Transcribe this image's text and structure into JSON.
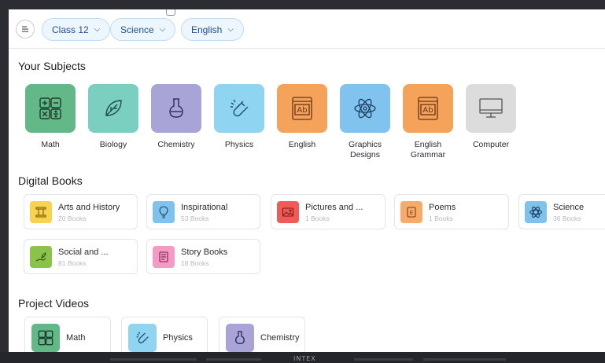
{
  "topbar": {
    "menu_icon": "menu-icon",
    "filters": [
      {
        "label": "Class 12"
      },
      {
        "label": "Science"
      },
      {
        "label": "English"
      }
    ]
  },
  "subjects_section": {
    "title": "Your Subjects",
    "items": [
      {
        "label": "Math",
        "icon": "calculator-icon",
        "color": "#62b887"
      },
      {
        "label": "Biology",
        "icon": "leaf-icon",
        "color": "#7bcfc0"
      },
      {
        "label": "Chemistry",
        "icon": "flask-icon",
        "color": "#a8a4d8"
      },
      {
        "label": "Physics",
        "icon": "magnet-icon",
        "color": "#8fd4f1"
      },
      {
        "label": "English",
        "icon": "ab-book-icon",
        "color": "#f5a35a"
      },
      {
        "label": "Graphics\nDesigns",
        "icon": "atom-icon",
        "color": "#7fc3ee"
      },
      {
        "label": "English\nGrammar",
        "icon": "ab-book-icon",
        "color": "#f5a35a"
      },
      {
        "label": "Computer",
        "icon": "monitor-icon",
        "color": "#dcdcdc"
      }
    ]
  },
  "books_section": {
    "title": "Digital Books",
    "items": [
      {
        "title": "Arts and History",
        "count": "20 Books",
        "icon": "column-icon",
        "color": "#f9d250"
      },
      {
        "title": "Inspirational",
        "count": "53 Books",
        "icon": "bulb-icon",
        "color": "#7fc2ec"
      },
      {
        "title": "Pictures and ...",
        "count": "1 Books",
        "icon": "picture-icon",
        "color": "#ef5b57"
      },
      {
        "title": "Poems",
        "count": "1 Books",
        "icon": "scroll-icon",
        "color": "#f7ab6a"
      },
      {
        "title": "Science",
        "count": "36 Books",
        "icon": "atom-icon",
        "color": "#7fc2ec"
      },
      {
        "title": "Social and ...",
        "count": "81 Books",
        "icon": "hand-plant-icon",
        "color": "#8bc34a"
      },
      {
        "title": "Story Books",
        "count": "18 Books",
        "icon": "storybook-icon",
        "color": "#f39bc4"
      }
    ]
  },
  "videos_section": {
    "title": "Project Videos",
    "items": [
      {
        "label": "Math",
        "icon": "calculator-icon",
        "color": "#62b887"
      },
      {
        "label": "Physics",
        "icon": "magnet-icon",
        "color": "#8fd4f1"
      },
      {
        "label": "Chemistry",
        "icon": "flask-icon",
        "color": "#a8a4d8"
      }
    ]
  },
  "bezel": {
    "brand": "INTEX"
  }
}
